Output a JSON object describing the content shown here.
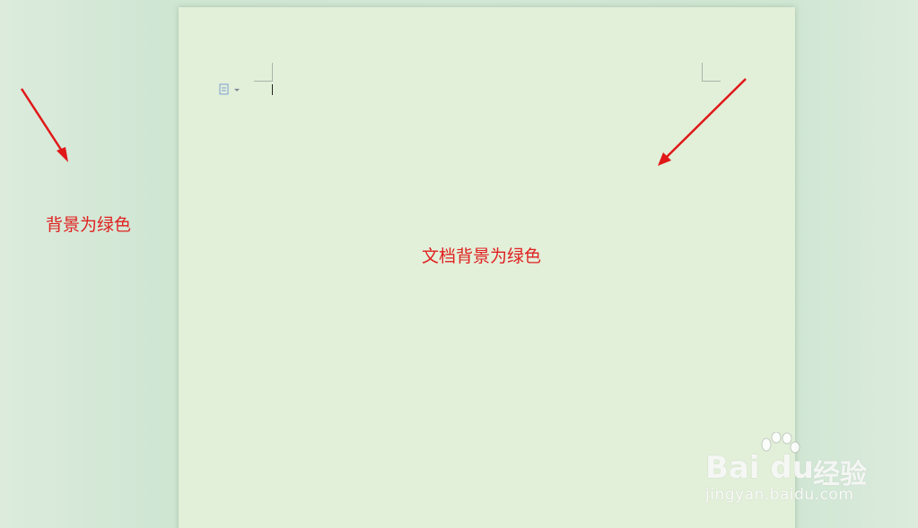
{
  "annotations": {
    "outer_background": "背景为绿色",
    "document_background": "文档背景为绿色"
  },
  "watermark": {
    "brand": "Bai du",
    "product": "经验",
    "url": "jingyan.baidu.com"
  },
  "colors": {
    "page_background": "#e2efd9",
    "outer_background": "#d3e8d6",
    "annotation_red": "#e02020"
  },
  "icons": {
    "paste_options": "paste-options-icon",
    "arrow": "red-arrow"
  }
}
